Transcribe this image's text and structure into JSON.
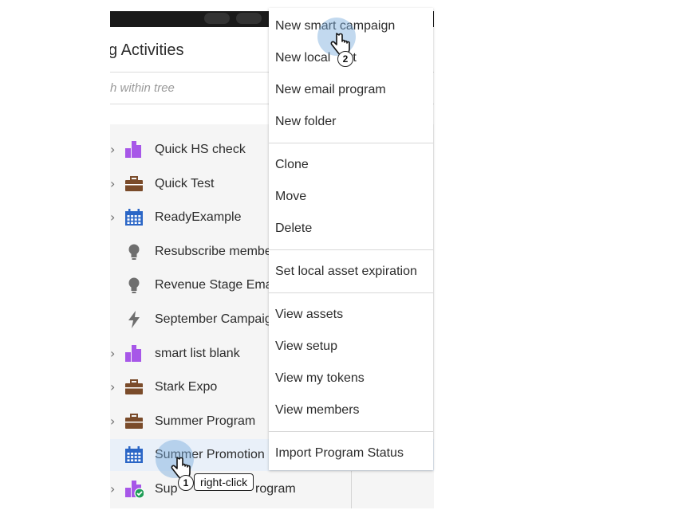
{
  "panel": {
    "title": "g Activities",
    "search_placeholder": "h within tree"
  },
  "tree": [
    {
      "label": "Quick HS check",
      "icon": "smart-list-icon",
      "expandable": true,
      "selected": false
    },
    {
      "label": "Quick Test",
      "icon": "briefcase-icon",
      "expandable": true,
      "selected": false
    },
    {
      "label": "ReadyExample",
      "icon": "calendar-icon",
      "expandable": true,
      "selected": false
    },
    {
      "label": "Resubscribe membe",
      "icon": "lightbulb-icon",
      "expandable": false,
      "selected": false
    },
    {
      "label": "Revenue Stage Emai",
      "icon": "lightbulb-icon",
      "expandable": false,
      "selected": false
    },
    {
      "label": "September Campaig",
      "icon": "lightning-icon",
      "expandable": false,
      "selected": false
    },
    {
      "label": "smart list blank",
      "icon": "smart-list-icon",
      "expandable": true,
      "selected": false
    },
    {
      "label": "Stark Expo",
      "icon": "briefcase-icon",
      "expandable": true,
      "selected": false
    },
    {
      "label": "Summer Program",
      "icon": "briefcase-icon",
      "expandable": true,
      "selected": false
    },
    {
      "label": "Summer Promotion",
      "icon": "calendar-icon",
      "expandable": false,
      "selected": true
    },
    {
      "label": "Sup",
      "icon": "smart-list-check-icon",
      "expandable": true,
      "selected": false
    },
    {
      "label": "rogram",
      "icon": "",
      "expandable": false,
      "selected": false
    }
  ],
  "context_menu": {
    "groups": [
      [
        "New smart campaign",
        "New local",
        "New email program",
        "New folder"
      ],
      [
        "Clone",
        "Move",
        "Delete"
      ],
      [
        "Set local asset expiration"
      ],
      [
        "View assets",
        "View setup",
        "View my tokens",
        "View members"
      ],
      [
        "Import Program Status"
      ]
    ],
    "local_suffix": "t"
  },
  "annotations": {
    "step1_number": "1",
    "step1_label": "right-click",
    "step2_number": "2"
  },
  "colors": {
    "purple": "#a757e8",
    "brown": "#7a4b2a",
    "blue": "#2b66c6",
    "gray_icon": "#6e6e6e",
    "green_check": "#1f9e57",
    "selected_row": "#e9f0f9"
  }
}
